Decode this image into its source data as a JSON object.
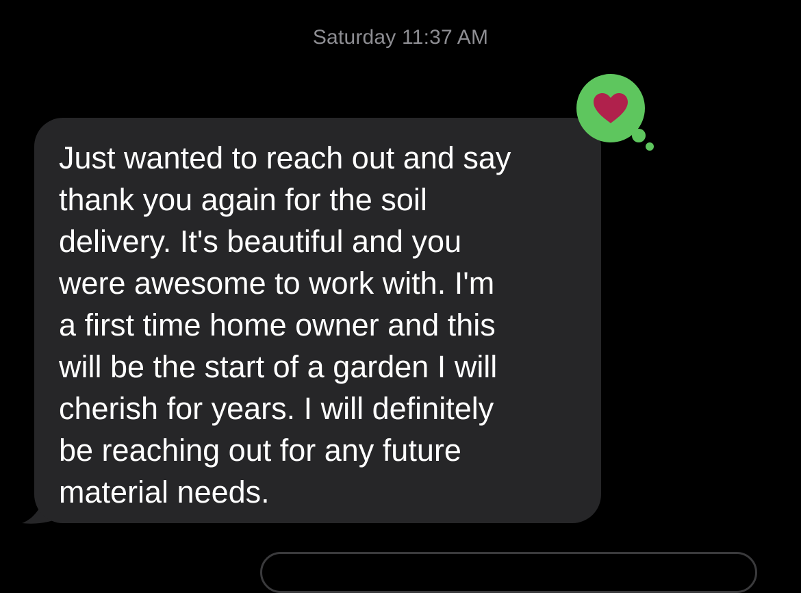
{
  "conversation": {
    "timestamp": "Saturday 11:37 AM",
    "messages": [
      {
        "direction": "incoming",
        "text": "Just wanted to reach out and say\nthank you again for the soil\ndelivery. It's beautiful  and you\nwere awesome to work with. I'm\na first time home owner and this\nwill be the start of a garden I will\ncherish for years. I will definitely\nbe reaching out for any future\nmaterial needs.",
        "tapback": {
          "icon": "heart-icon",
          "bubble_color": "#5ec65e",
          "heart_color": "#b0214c"
        }
      }
    ]
  },
  "colors": {
    "background": "#000000",
    "incoming_bubble": "#262628",
    "timestamp_text": "#8e8e93"
  }
}
